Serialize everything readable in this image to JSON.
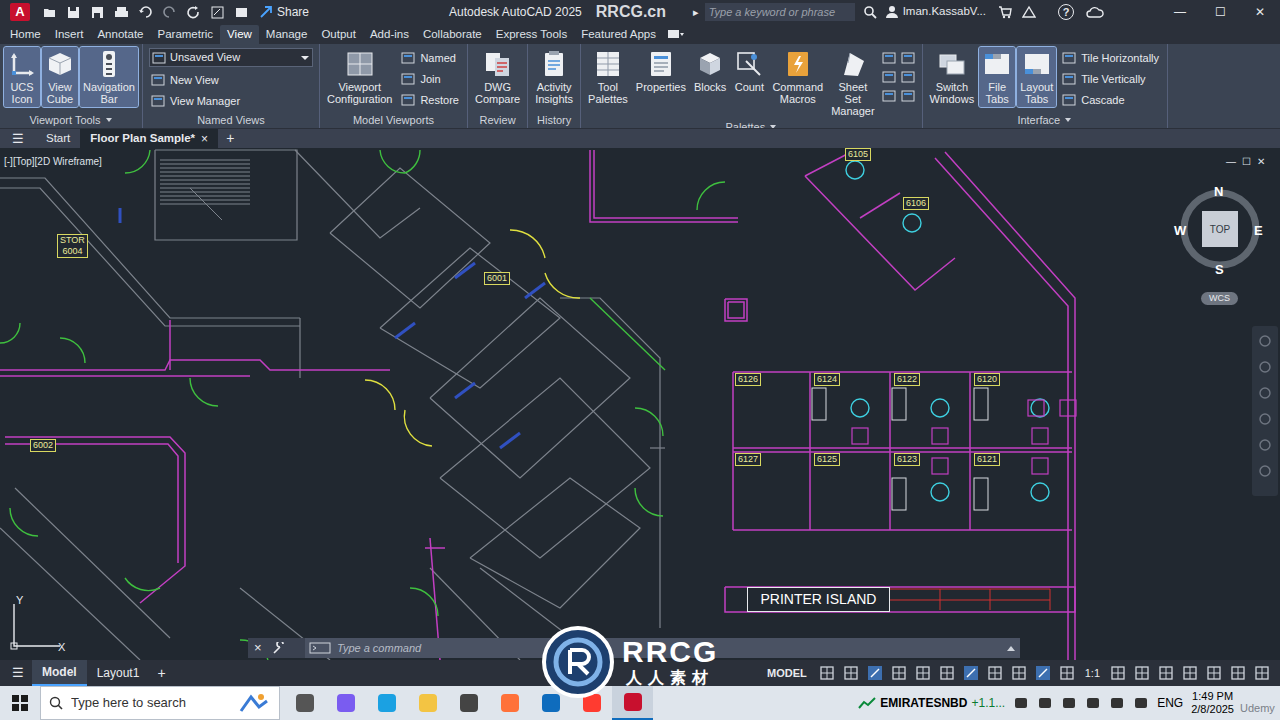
{
  "window": {
    "app_logo": "A",
    "title": "Autodesk AutoCAD 2025",
    "watermark": "RRCG.cn",
    "share": "Share",
    "search_arrow": "▸",
    "search": {
      "placeholder": "Type a keyword or phrase"
    },
    "user": "Iman.KassabV...",
    "help": "?",
    "controls": [
      "—",
      "☐",
      "✕"
    ]
  },
  "ribbon_tabs": [
    {
      "label": "Home",
      "selected": false
    },
    {
      "label": "Insert",
      "selected": false
    },
    {
      "label": "Annotate",
      "selected": false
    },
    {
      "label": "Parametric",
      "selected": false
    },
    {
      "label": "View",
      "selected": true
    },
    {
      "label": "Manage",
      "selected": false
    },
    {
      "label": "Output",
      "selected": false
    },
    {
      "label": "Add-ins",
      "selected": false
    },
    {
      "label": "Collaborate",
      "selected": false
    },
    {
      "label": "Express Tools",
      "selected": false
    },
    {
      "label": "Featured Apps",
      "selected": false
    }
  ],
  "ribbon_groups": [
    {
      "title": "Viewport Tools",
      "has_menu": true,
      "items": [
        {
          "kind": "large",
          "label": "UCS Icon",
          "selected": true
        },
        {
          "kind": "large",
          "label": "View Cube",
          "selected": true
        },
        {
          "kind": "large",
          "label": "Navigation Bar",
          "selected": true
        }
      ]
    },
    {
      "title": "Named Views",
      "has_menu": false,
      "items": [
        {
          "kind": "dropdown",
          "label": "Unsaved View",
          "selected": false
        },
        {
          "kind": "small",
          "label": "New View",
          "selected": false
        },
        {
          "kind": "small",
          "label": "View Manager",
          "selected": false
        }
      ]
    },
    {
      "title": "Model Viewports",
      "has_menu": false,
      "items": [
        {
          "kind": "large",
          "label": "Viewport Configuration",
          "selected": false
        },
        {
          "kind": "small",
          "label": "Named",
          "selected": false
        },
        {
          "kind": "small",
          "label": "Join",
          "selected": false
        },
        {
          "kind": "small",
          "label": "Restore",
          "selected": false
        }
      ]
    },
    {
      "title": "Review",
      "has_menu": false,
      "items": [
        {
          "kind": "large",
          "label": "DWG Compare",
          "selected": false
        }
      ]
    },
    {
      "title": "History",
      "has_menu": false,
      "items": [
        {
          "kind": "large",
          "label": "Activity Insights",
          "selected": false
        }
      ]
    },
    {
      "title": "Palettes",
      "has_menu": true,
      "items": [
        {
          "kind": "large",
          "label": "Tool Palettes",
          "selected": false
        },
        {
          "kind": "large",
          "label": "Properties",
          "selected": false
        },
        {
          "kind": "large",
          "label": "Blocks",
          "selected": false
        },
        {
          "kind": "large",
          "label": "Count",
          "selected": false
        },
        {
          "kind": "large",
          "label": "Command Macros",
          "selected": false
        },
        {
          "kind": "large",
          "label": "Sheet Set Manager",
          "selected": false
        },
        {
          "kind": "icons",
          "selected": false
        }
      ]
    },
    {
      "title": "Interface",
      "has_menu": true,
      "items": [
        {
          "kind": "large",
          "label": "Switch Windows",
          "selected": false
        },
        {
          "kind": "large",
          "label": "File Tabs",
          "selected": true
        },
        {
          "kind": "large",
          "label": "Layout Tabs",
          "selected": true
        },
        {
          "kind": "small",
          "label": "Tile Horizontally",
          "selected": false
        },
        {
          "kind": "small",
          "label": "Tile Vertically",
          "selected": false
        },
        {
          "kind": "small",
          "label": "Cascade",
          "selected": false
        }
      ]
    }
  ],
  "file_tabs": {
    "menu": "☰",
    "tabs": [
      {
        "label": "Start",
        "selected": false
      },
      {
        "label": "Floor Plan Sample*",
        "selected": true,
        "close": "×"
      }
    ],
    "add": "+"
  },
  "viewport": {
    "label": "[-][Top][2D Wireframe]",
    "controls": [
      "—",
      "☐",
      "✕"
    ],
    "rooms": [
      {
        "label": "6004",
        "prefix": "STOR"
      },
      {
        "label": "6001"
      },
      {
        "label": "6002"
      },
      {
        "label": "6105"
      },
      {
        "label": "6106"
      },
      {
        "label": "6126"
      },
      {
        "label": "6124"
      },
      {
        "label": "6122"
      },
      {
        "label": "6120"
      },
      {
        "label": "6127"
      },
      {
        "label": "6125"
      },
      {
        "label": "6123"
      },
      {
        "label": "6121"
      }
    ],
    "printer": "PRINTER ISLAND",
    "viewcube": {
      "n": "N",
      "s": "S",
      "e": "E",
      "w": "W",
      "face": "TOP",
      "ucs": "WCS"
    },
    "axes": {
      "x": "X",
      "y": "Y"
    }
  },
  "command": {
    "close": "×",
    "placeholder": "Type a command"
  },
  "status": {
    "menu": "☰",
    "layouts": [
      {
        "label": "Model",
        "selected": true
      },
      {
        "label": "Layout1",
        "selected": false
      }
    ],
    "add": "+",
    "space": "MODEL",
    "scale": "1:1"
  },
  "taskbar": {
    "search": {
      "placeholder": "Type here to search"
    },
    "stock": {
      "name": "EMIRATESNBD",
      "change": "+1.1..."
    },
    "language": "ENG",
    "time": "1:49 PM",
    "date": "2/8/2025"
  },
  "overlay": {
    "logo": "RRCG",
    "logo_sub": "人人素材",
    "udemy": "Udemy"
  }
}
